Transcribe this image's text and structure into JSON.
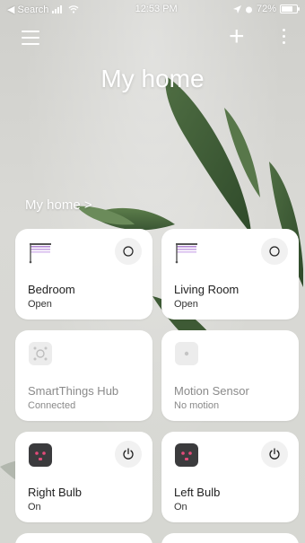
{
  "status_bar": {
    "back_label": "◀ Search",
    "time": "12:53 PM",
    "battery": "72%"
  },
  "header": {
    "title": "My home",
    "home_link": "My home >"
  },
  "devices": [
    {
      "name": "Bedroom",
      "status": "Open",
      "icon": "blind-icon",
      "action": "circle-icon"
    },
    {
      "name": "Living Room",
      "status": "Open",
      "icon": "blind-icon",
      "action": "circle-icon"
    },
    {
      "name": "SmartThings Hub",
      "status": "Connected",
      "icon": "hub-icon",
      "action": ""
    },
    {
      "name": "Motion Sensor",
      "status": "No motion",
      "icon": "sensor-icon",
      "action": ""
    },
    {
      "name": "Right Bulb",
      "status": "On",
      "icon": "plug-icon",
      "action": "power-icon"
    },
    {
      "name": "Left Bulb",
      "status": "On",
      "icon": "plug-icon",
      "action": "power-icon"
    }
  ],
  "colors": {
    "blind_accent": "#b58ad6",
    "plug_dark": "#3b3b3d",
    "plug_face": "#e44b7a"
  },
  "battery_level": 0.72
}
